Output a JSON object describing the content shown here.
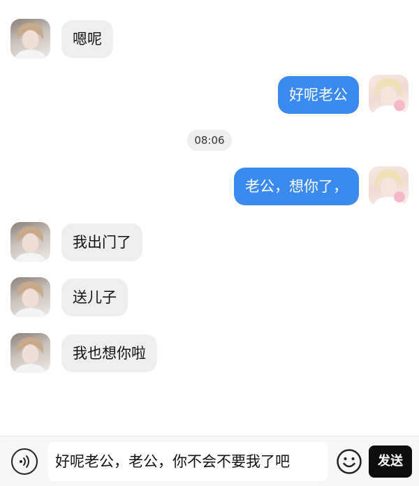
{
  "messages": [
    {
      "side": "in",
      "text": "嗯呢",
      "avatar": "contact-avatar"
    },
    {
      "side": "out",
      "text": "好呢老公",
      "avatar": "self-avatar"
    },
    {
      "side": "out",
      "text": "老公，想你了，",
      "avatar": "self-avatar"
    },
    {
      "side": "in",
      "text": "我出门了",
      "avatar": "contact-avatar"
    },
    {
      "side": "in",
      "text": "送儿子",
      "avatar": "contact-avatar"
    },
    {
      "side": "in",
      "text": "我也想你啦",
      "avatar": "contact-avatar"
    }
  ],
  "timestamp": "08:06",
  "composer": {
    "input_text": "好呢老公，老公，你不会不要我了吧",
    "send_label": "发送",
    "voice_icon": "voice-icon",
    "emoji_icon": "emoji-icon"
  },
  "colors": {
    "outgoing_bubble": "#3a8af0",
    "incoming_bubble": "#eeeeee",
    "send_button": "#0d0d0d"
  }
}
